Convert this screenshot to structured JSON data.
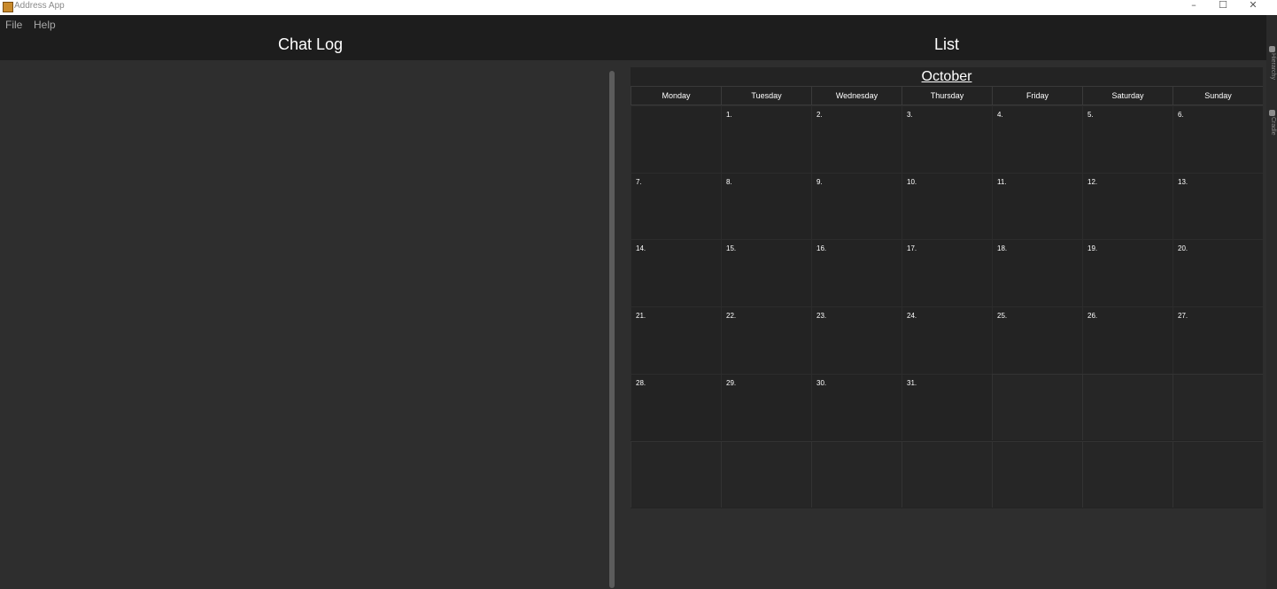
{
  "window": {
    "title": "Address App",
    "controls": [
      "–",
      "☐",
      "✕"
    ]
  },
  "menu": {
    "items": [
      "File",
      "Help"
    ]
  },
  "headers": {
    "left": "Chat Log",
    "right": "List"
  },
  "calendar": {
    "month": "October",
    "weekdays": [
      "Monday",
      "Tuesday",
      "Wednesday",
      "Thursday",
      "Friday",
      "Saturday",
      "Sunday"
    ],
    "days": [
      "",
      "1.",
      "2.",
      "3.",
      "4.",
      "5.",
      "6.",
      "7.",
      "8.",
      "9.",
      "10.",
      "11.",
      "12.",
      "13.",
      "14.",
      "15.",
      "16.",
      "17.",
      "18.",
      "19.",
      "20.",
      "21.",
      "22.",
      "23.",
      "24.",
      "25.",
      "26.",
      "27.",
      "28.",
      "29.",
      "30.",
      "31.",
      "",
      "",
      "",
      "",
      "",
      "",
      "",
      "",
      "",
      ""
    ]
  },
  "side_tools": {
    "labels": [
      "Hierarchy",
      "Cradle"
    ]
  },
  "colors": {
    "background": "#2e2e2e",
    "header": "#1d1d1d",
    "calendar": "#232323",
    "text": "#ffffff"
  }
}
